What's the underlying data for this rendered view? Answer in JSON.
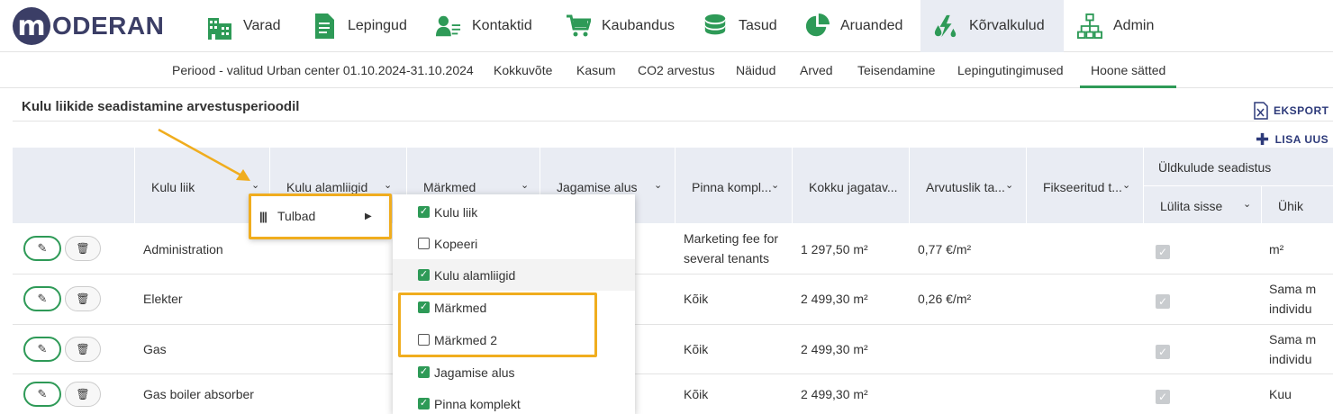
{
  "app": {
    "logo_letter": "m",
    "logo_text": "ODERAN"
  },
  "nav": [
    {
      "label": "Varad",
      "icon": "buildings-icon"
    },
    {
      "label": "Lepingud",
      "icon": "document-icon"
    },
    {
      "label": "Kontaktid",
      "icon": "contacts-icon"
    },
    {
      "label": "Kaubandus",
      "icon": "cart-icon"
    },
    {
      "label": "Tasud",
      "icon": "coins-icon"
    },
    {
      "label": "Aruanded",
      "icon": "pie-chart-icon"
    },
    {
      "label": "Kõrvalkulud",
      "icon": "utilities-icon",
      "active": true
    },
    {
      "label": "Admin",
      "icon": "org-chart-icon"
    }
  ],
  "subnav": {
    "period": "Periood - valitud Urban center 01.10.2024-31.10.2024",
    "items": [
      "Kokkuvõte",
      "Kasum",
      "CO2 arvestus",
      "Näidud",
      "Arved",
      "Teisendamine",
      "Lepingutingimused",
      "Hoone sätted"
    ],
    "active": "Hoone sätted"
  },
  "page": {
    "title": "Kulu liikide seadistamine arvestusperioodil",
    "export_label": "EKSPORT",
    "add_label": "LISA UUS"
  },
  "table": {
    "columns": [
      "Kulu liik",
      "Kulu alamliigid",
      "Märkmed",
      "Jagamise alus",
      "Pinna komplekt",
      "Kokku jagatav...",
      "Arvutuslik ta...",
      "Fikseeritud t..."
    ],
    "col_display": [
      "Kulu liik",
      "Kulu alamliigid",
      "Märkmed",
      "Jagamise alus",
      "Pinna kompl...",
      "Kokku jagatav...",
      "Arvutuslik ta...",
      "Fikseeritud t..."
    ],
    "group_header": "Üldkulude seadistus",
    "group_sub": [
      "Lülita sisse",
      "Ühik"
    ],
    "rows": [
      {
        "kulu_liik": "Administration",
        "pinna_line1": "Marketing fee for",
        "pinna_line2": "several tenants",
        "kokku": "1 297,50 m²",
        "arvutuslik": "0,77 €/m²",
        "uhik_line1": "m²",
        "uhik_line2": ""
      },
      {
        "kulu_liik": "Elekter",
        "pinna_line1": "Kõik",
        "pinna_line2": "",
        "kokku": "2 499,30 m²",
        "arvutuslik": "0,26 €/m²",
        "uhik_line1": "Sama m",
        "uhik_line2": "individu"
      },
      {
        "kulu_liik": "Gas",
        "pinna_line1": "Kõik",
        "pinna_line2": "",
        "kokku": "2 499,30 m²",
        "arvutuslik": "",
        "uhik_line1": "Sama m",
        "uhik_line2": "individu"
      },
      {
        "kulu_liik": "Gas boiler absorber",
        "pinna_line1": "Kõik",
        "pinna_line2": "",
        "kokku": "2 499,30 m²",
        "arvutuslik": "",
        "uhik_line1": "Kuu",
        "uhik_line2": ""
      }
    ]
  },
  "column_menu": {
    "trigger_label": "Tulbad",
    "items": [
      {
        "label": "Kulu liik",
        "checked": true
      },
      {
        "label": "Kopeeri",
        "checked": false
      },
      {
        "label": "Kulu alamliigid",
        "checked": true
      },
      {
        "label": "Märkmed",
        "checked": true
      },
      {
        "label": "Märkmed 2",
        "checked": false
      },
      {
        "label": "Jagamise alus",
        "checked": true
      },
      {
        "label": "Pinna komplekt",
        "checked": true
      }
    ]
  },
  "colors": {
    "brand": "#3b3e66",
    "accent_green": "#2e9a57",
    "highlight": "#f0ad1e",
    "header_bg": "#e9ecf3",
    "link_blue": "#2d3a7a"
  }
}
